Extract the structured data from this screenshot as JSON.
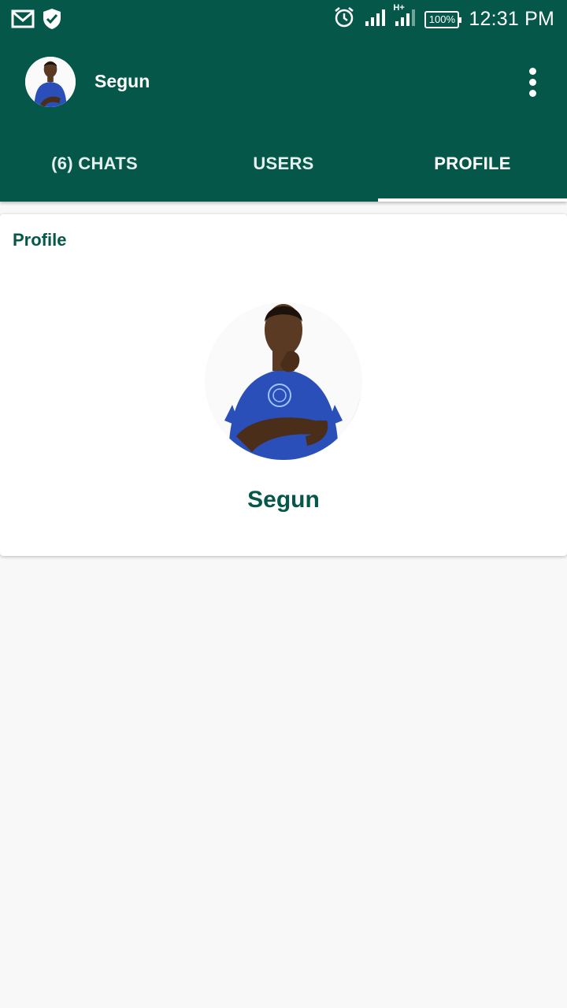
{
  "status_bar": {
    "time": "12:31 PM",
    "battery": "100%",
    "network": "H+",
    "icons": [
      "gmail-icon",
      "shield-icon",
      "alarm-icon",
      "signal-icon",
      "signal-hplus-icon",
      "battery-icon"
    ]
  },
  "toolbar": {
    "title": "Segun",
    "menu_icon": "more-vert-icon"
  },
  "tabs": [
    {
      "label": "(6) CHATS",
      "active": false
    },
    {
      "label": "USERS",
      "active": false
    },
    {
      "label": "PROFILE",
      "active": true
    }
  ],
  "profile_card": {
    "title": "Profile",
    "name": "Segun"
  },
  "colors": {
    "primary": "#05574a",
    "background": "#f8f8f8",
    "shirt": "#2a4fb8",
    "skin": "#5a3a22"
  }
}
